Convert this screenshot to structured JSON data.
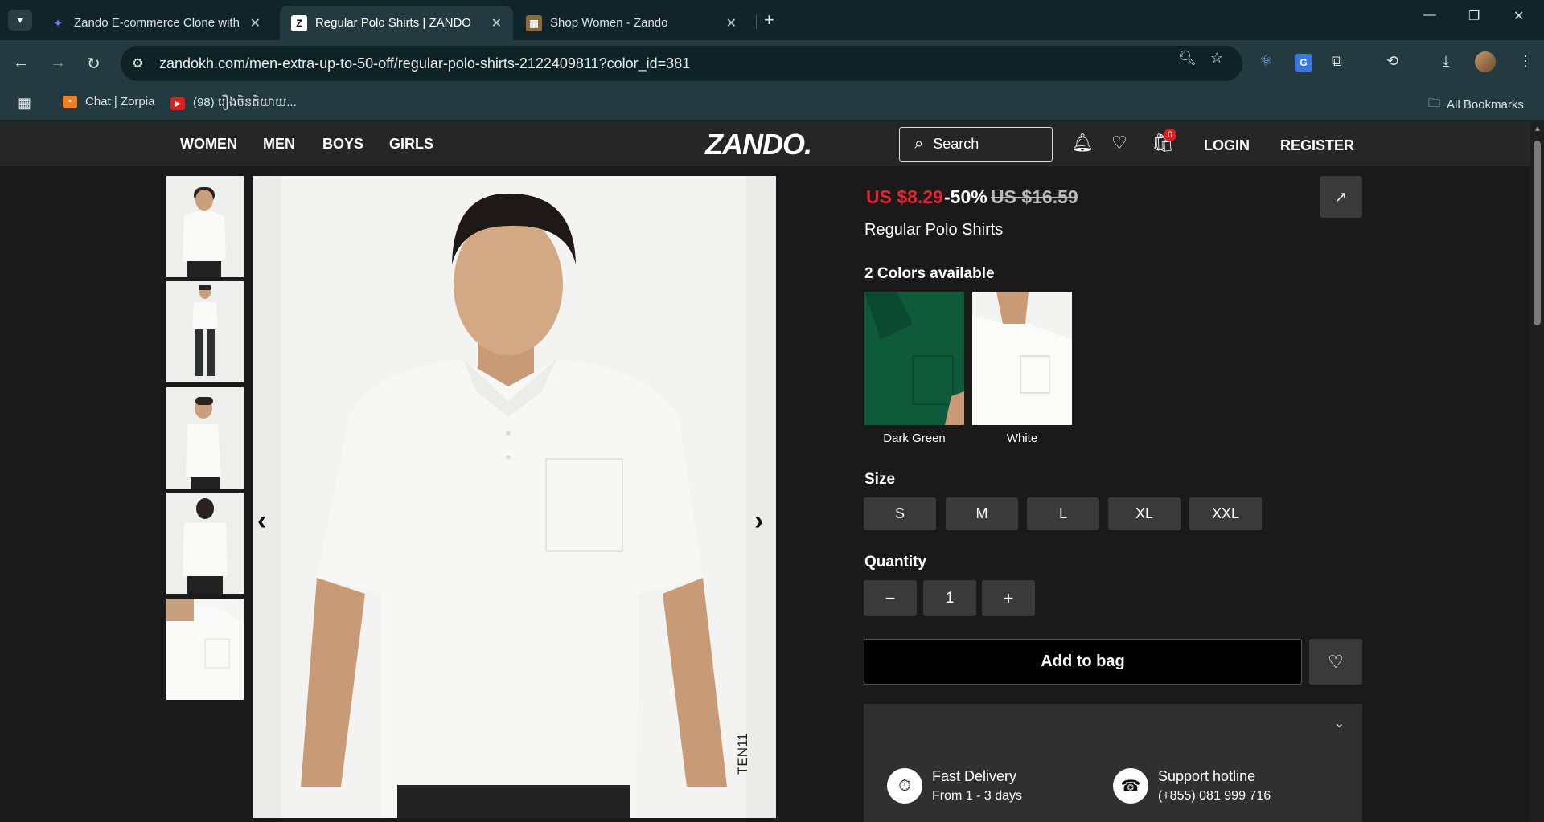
{
  "browser": {
    "tabs": [
      {
        "title": "Zando E-commerce Clone with",
        "favicon": "codeium-icon"
      },
      {
        "title": "Regular Polo Shirts | ZANDO",
        "favicon": "zando-favicon"
      },
      {
        "title": "Shop Women - Zando",
        "favicon": "zando-image-favicon"
      }
    ],
    "url": "zandokh.com/men-extra-up-to-50-off/regular-polo-shirts-2122409811?color_id=381",
    "bookmarks": [
      {
        "label": "Chat | Zorpia"
      },
      {
        "label": "(98) រឿងចិនតិយាយ..."
      }
    ],
    "all_bookmarks": "All Bookmarks"
  },
  "site": {
    "nav": [
      "WOMEN",
      "MEN",
      "BOYS",
      "GIRLS"
    ],
    "logo": "ZANDO.",
    "search_label": "Search",
    "cart_count": "0",
    "login": "LOGIN",
    "register": "REGISTER"
  },
  "product": {
    "price_now": "US $8.29",
    "discount": "-50%",
    "price_old": "US $16.59",
    "name": "Regular Polo Shirts",
    "colors_heading": "2 Colors available",
    "colors": [
      {
        "name": "Dark Green",
        "hex": "#0e5a3a"
      },
      {
        "name": "White",
        "hex": "#f3f3f1"
      }
    ],
    "size_heading": "Size",
    "sizes": [
      "S",
      "M",
      "L",
      "XL",
      "XXL"
    ],
    "quantity_heading": "Quantity",
    "quantity": "1",
    "add_to_bag": "Add to bag",
    "sku_tag": "TEN11",
    "features": [
      {
        "title": "Fast Delivery",
        "subtitle": "From 1 - 3 days",
        "icon": "fast-delivery-icon"
      },
      {
        "title": "Support hotline",
        "subtitle": "(+855) 081 999 716",
        "icon": "support-headset-icon"
      }
    ]
  },
  "colors": {
    "price_red": "#e2262f",
    "header_bg": "#262626",
    "page_bg": "#1a1a1a"
  }
}
